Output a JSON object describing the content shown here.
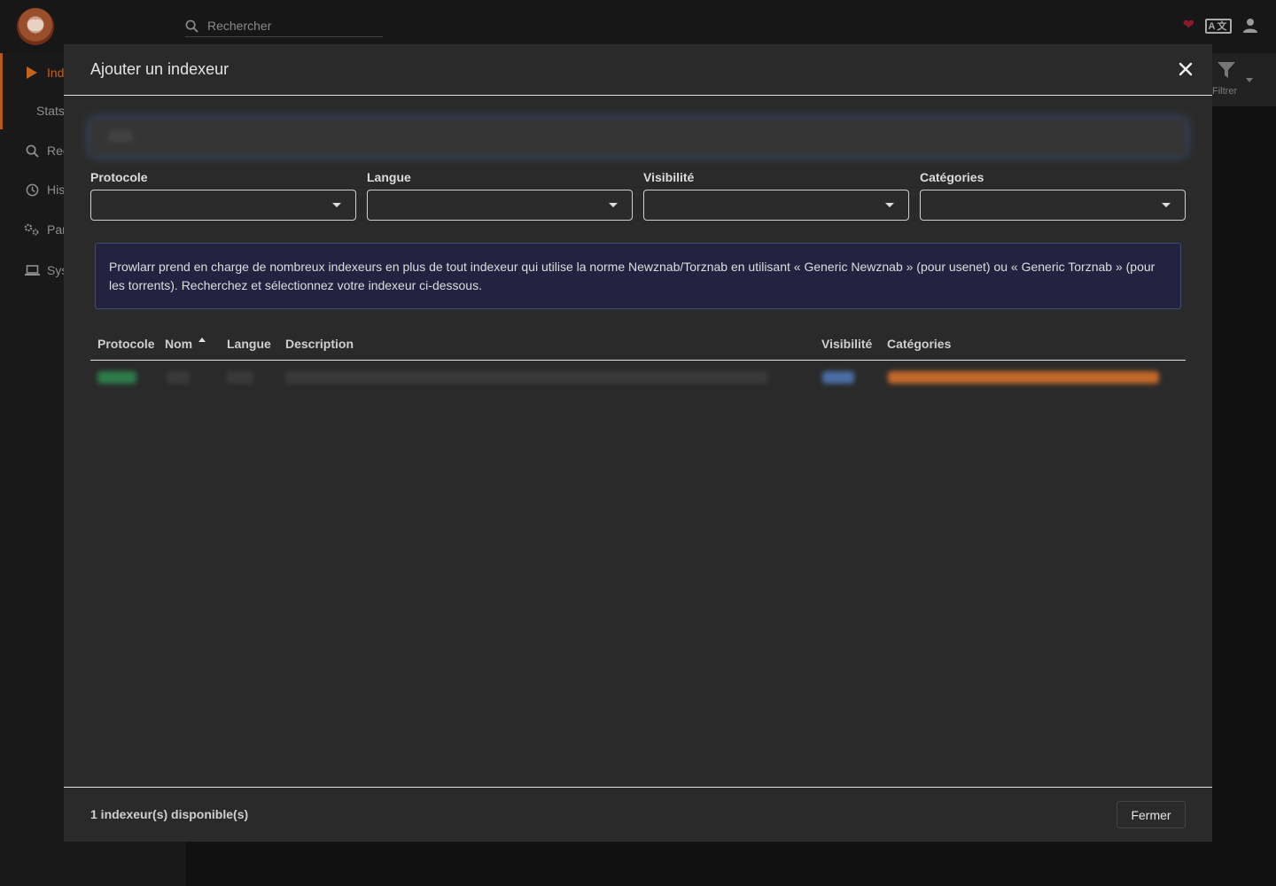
{
  "app": {
    "search_placeholder": "Rechercher",
    "sidebar": [
      {
        "label": "Indexeurs",
        "icon": "play-icon",
        "active": true
      },
      {
        "label": "Stats",
        "icon": "",
        "sub": true
      },
      {
        "label": "Rechercher",
        "icon": "search-icon"
      },
      {
        "label": "Historique",
        "icon": "clock-icon"
      },
      {
        "label": "Paramètres",
        "icon": "cogs-icon"
      },
      {
        "label": "Système",
        "icon": "laptop-icon"
      }
    ],
    "toolbar": {
      "filter_label": "Filtrer"
    },
    "top_icons": [
      "heart-icon",
      "translate-icon",
      "user-icon"
    ]
  },
  "modal": {
    "title": "Ajouter un indexeur",
    "filters": [
      {
        "label": "Protocole",
        "value": ""
      },
      {
        "label": "Langue",
        "value": ""
      },
      {
        "label": "Visibilité",
        "value": ""
      },
      {
        "label": "Catégories",
        "value": ""
      }
    ],
    "info": "Prowlarr prend en charge de nombreux indexeurs en plus de tout indexeur qui utilise la norme Newznab/Torznab en utilisant « Generic Newznab » (pour usenet) ou « Generic Torznab » (pour les torrents). Recherchez et sélectionnez votre indexeur ci-dessous.",
    "table": {
      "columns": [
        "Protocole",
        "Nom",
        "Langue",
        "Description",
        "Visibilité",
        "Catégories"
      ],
      "sorted_column": "Nom",
      "sort_direction": "ascending"
    },
    "footer": {
      "count_text": "1 indexeur(s) disponible(s)",
      "close_label": "Fermer"
    }
  },
  "colors": {
    "accent": "#b55a17",
    "protocol_badge": "#2e7d4a",
    "visibility_badge": "#4a6fa5",
    "category_badge": "#c46a2a",
    "info_background": "#232341"
  }
}
